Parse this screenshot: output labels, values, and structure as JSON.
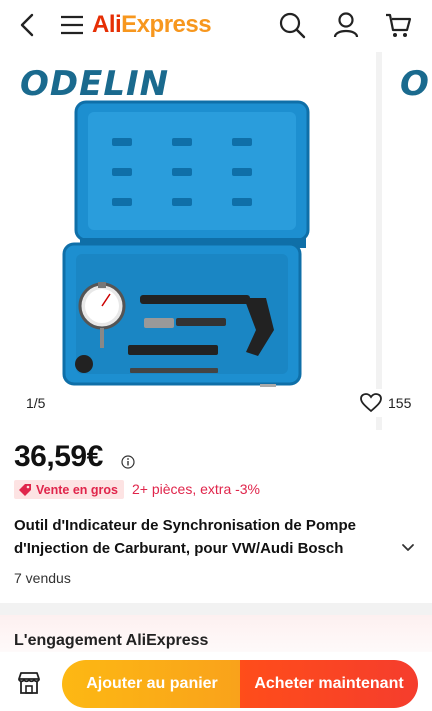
{
  "header": {
    "logo_part1": "Ali",
    "logo_part2": "Express",
    "icons": [
      "back-arrow-icon",
      "menu-icon",
      "search-icon",
      "account-icon",
      "cart-icon"
    ]
  },
  "gallery": {
    "brand": "ODELIN",
    "brand_next": "O",
    "pager": "1/5",
    "likes": "155"
  },
  "product": {
    "price": "36,59€",
    "badge": "Vente en gros",
    "discount": "2+ pièces, extra -3%",
    "title": "Outil d'Indicateur de Synchronisation de Pompe d'Injection de Carburant, pour VW/Audi Bosch",
    "sold": "7 vendus"
  },
  "engagement": {
    "title": "L'engagement AliExpress"
  },
  "actions": {
    "add_to_cart": "Ajouter au panier",
    "buy_now": "Acheter maintenant"
  },
  "colors": {
    "accent_red": "#e0254b",
    "cart_button": "#fdb813",
    "buy_button": "#ff4d1a",
    "case_blue": "#1d8fd0"
  }
}
